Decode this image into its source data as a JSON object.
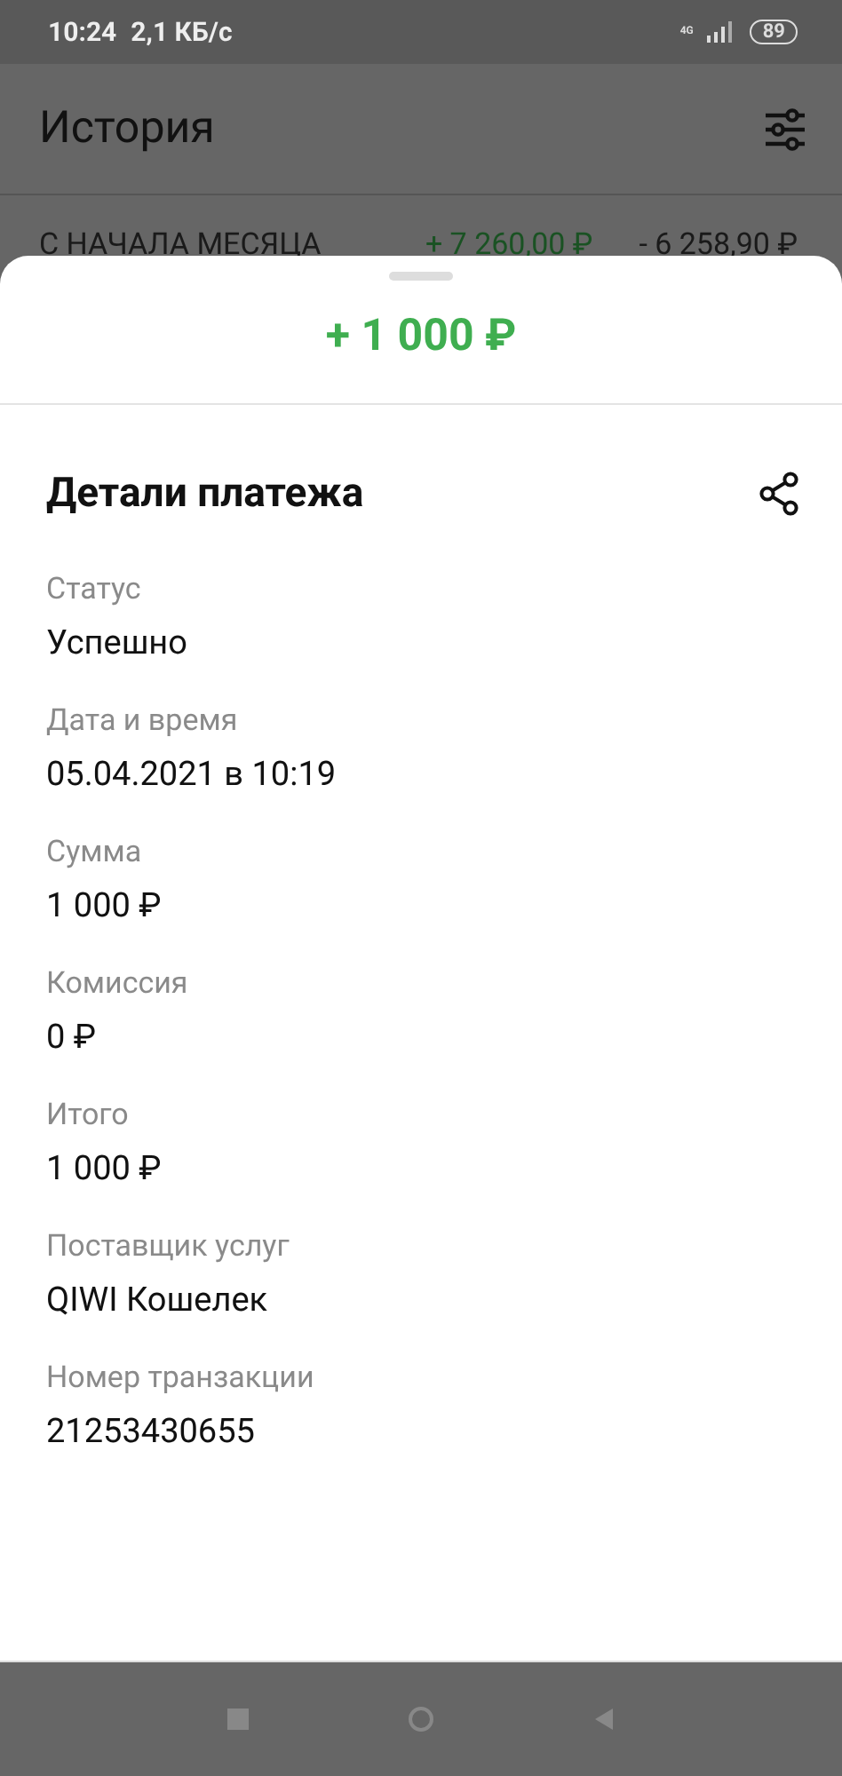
{
  "status_bar": {
    "time": "10:24",
    "speed": "2,1 КБ/с",
    "network": "4G",
    "battery": "89"
  },
  "header": {
    "title": "История"
  },
  "summary": {
    "label": "С НАЧАЛА МЕСЯЦА",
    "income": "+ 7 260,00 ₽",
    "expense": "- 6 258,90 ₽"
  },
  "sheet": {
    "amount": "+ 1 000 ₽",
    "title": "Детали платежа",
    "details": [
      {
        "label": "Статус",
        "value": "Успешно"
      },
      {
        "label": "Дата и время",
        "value": "05.04.2021 в 10:19"
      },
      {
        "label": "Сумма",
        "value": "1 000 ₽"
      },
      {
        "label": "Комиссия",
        "value": "0 ₽"
      },
      {
        "label": "Итого",
        "value": "1 000 ₽"
      },
      {
        "label": "Поставщик услуг",
        "value": "QIWI Кошелек"
      },
      {
        "label": "Номер транзакции",
        "value": "21253430655"
      }
    ]
  }
}
